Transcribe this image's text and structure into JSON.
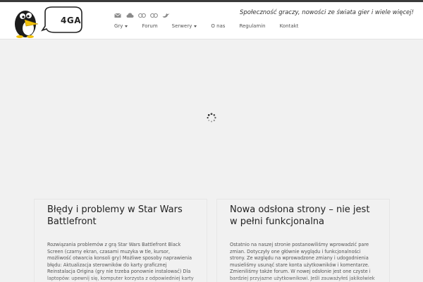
{
  "site": {
    "logo_text": "4GA",
    "tagline": "Społeczność graczy, nowości ze świata gier i wiele więcej!"
  },
  "social_icons": [
    "mail-icon",
    "cloud-icon",
    "flickr-icon",
    "flickr-icon",
    "bird-icon"
  ],
  "nav": {
    "items": [
      {
        "label": "Gry",
        "dropdown": true
      },
      {
        "label": "Forum",
        "dropdown": false
      },
      {
        "label": "Serwery",
        "dropdown": true
      },
      {
        "label": "O nas",
        "dropdown": false
      },
      {
        "label": "Regulamin",
        "dropdown": false
      },
      {
        "label": "Kontakt",
        "dropdown": false
      }
    ]
  },
  "posts": [
    {
      "title": "Błędy i problemy w Star Wars Battlefront",
      "excerpt": "Rozwiązania problemów z grą Star Wars Battlefront   Black Screen (czarny ekran, czasami muzyka w tle, kursor, możliwość otwarcia konsoli gry)  Możliwe sposoby naprawienia błędu: Aktualizacja sterowników do karty graficznej Reinstalacja Origina (gry nie trzeba ponownie instalować) Dla laptopów: upewnij się, komputer korzysta z odpowiedniej karty graficznej Wyłącz SLI/Crossfire Stwórz [...]"
    },
    {
      "title": "Nowa odsłona strony – nie jest w pełni funkcjonalna",
      "excerpt": "Ostatnio na naszej stronie postanowiliśmy wprowadzić pare zmian. Dotyczyły one głównie wyglądu i funkcjonalności strony. Ze względu na wprowadzone zmiany i udogodnienia musieliśmy usunąć stare konta użytkowników i komentarze. Zmieniliśmy także forum. W nowej odsłonie jest one czyste i bardziej przyjazne użytkownikowi.   Jeśli zauważyłeś jakikolwiek błąd na naszej stronie [...]"
    }
  ],
  "colors": {
    "background": "#f1f1f1",
    "header": "#ffffff",
    "topbar": "#3a3a3a",
    "icon_gray": "#8a8a8a"
  }
}
